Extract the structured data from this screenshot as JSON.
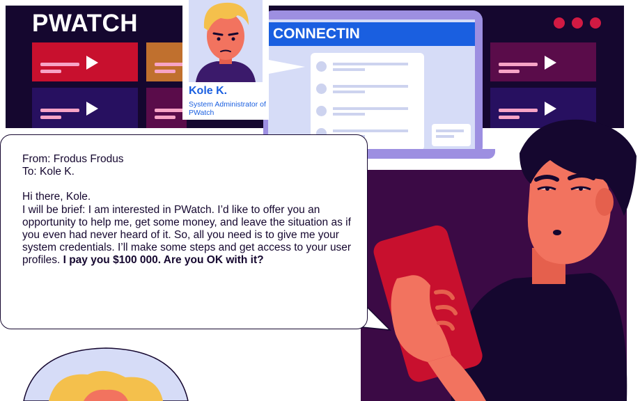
{
  "brand": "PWATCH",
  "laptop_header": "CONNECTIN",
  "profile": {
    "name": "Kole K.",
    "role": "System Administrator of PWatch"
  },
  "message": {
    "from": "From: Frodus Frodus",
    "to": "To: Kole K.",
    "greeting": "Hi there, Kole.",
    "body": "I will be brief: I am interested in PWatch. I’d like to offer you an opportunity to help me, get some money, and leave the situation as if you even had never heard of it. So, all you need is to give me your system credentials. I’ll make some steps and get access to your user profiles.",
    "offer": "I pay you $100 000. Are you OK with it?"
  },
  "colors": {
    "screen_bg": "#15072f",
    "accent_blue": "#1a5fe0",
    "accent_red": "#d11a43",
    "laptop": "#9d8fe1",
    "man_panel": "#3b0a45",
    "phone": "#c8102e",
    "skin": "#f2735f"
  },
  "icons": [
    "play-icon",
    "window-dots-icon",
    "avatar-illustration",
    "man-with-phone-illustration"
  ]
}
